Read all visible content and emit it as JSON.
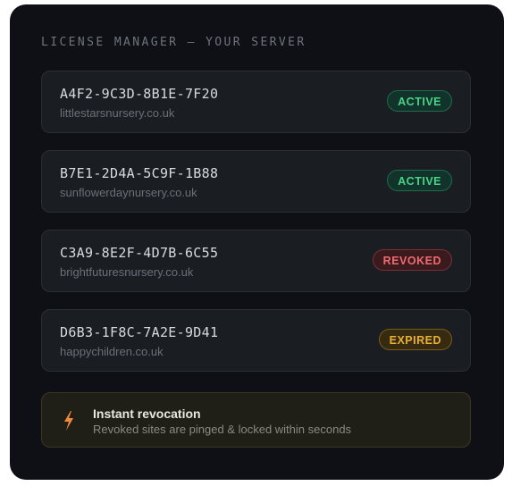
{
  "panel": {
    "title": "LICENSE MANAGER — YOUR SERVER"
  },
  "licenses": [
    {
      "key": "A4F2-9C3D-8B1E-7F20",
      "domain": "littlestarsnursery.co.uk",
      "status": "ACTIVE",
      "status_color": "#46d38a"
    },
    {
      "key": "B7E1-2D4A-5C9F-1B88",
      "domain": "sunflowerdaynursery.co.uk",
      "status": "ACTIVE",
      "status_color": "#46d38a"
    },
    {
      "key": "C3A9-8E2F-4D7B-6C55",
      "domain": "brightfuturesnursery.co.uk",
      "status": "REVOKED",
      "status_color": "#ef6b72"
    },
    {
      "key": "D6B3-1F8C-7A2E-9D41",
      "domain": "happychildren.co.uk",
      "status": "EXPIRED",
      "status_color": "#e9b132"
    }
  ],
  "notice": {
    "icon": "lightning-bolt-icon",
    "icon_color": "#f08a3c",
    "title": "Instant revocation",
    "subtitle": "Revoked sites are pinged & locked within seconds"
  }
}
